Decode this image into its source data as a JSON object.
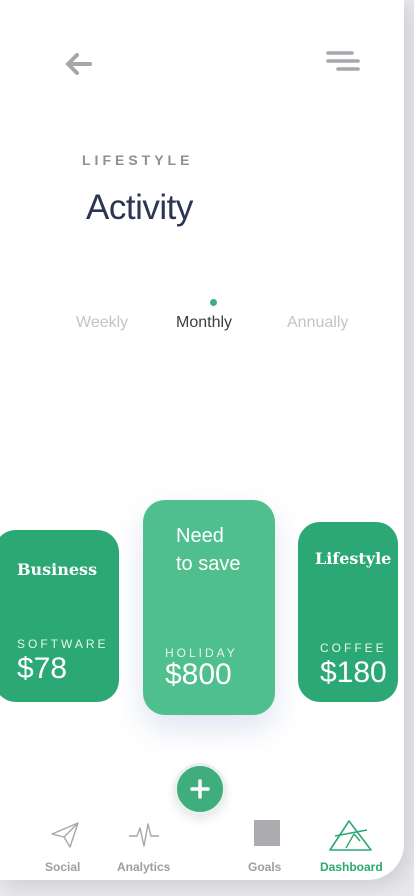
{
  "header": {
    "back_icon": "arrow-left-icon",
    "menu_icon": "menu-lines-icon",
    "category": "LIFESTYLE",
    "title": "Activity"
  },
  "tabs": [
    {
      "label": "Weekly",
      "active": false
    },
    {
      "label": "Monthly",
      "active": true
    },
    {
      "label": "Annually",
      "active": false
    }
  ],
  "cards": [
    {
      "title": "Business",
      "subtitle": "SOFTWARE",
      "amount": "$78"
    },
    {
      "title_line1": "Need",
      "title_line2": "to save",
      "subtitle": "HOLIDAY",
      "amount": "$800"
    },
    {
      "title": "Lifestyle",
      "subtitle": "COFFEE",
      "amount": "$180"
    }
  ],
  "fab": {
    "icon": "plus-icon"
  },
  "nav": [
    {
      "label": "Social",
      "icon": "paper-plane-icon",
      "active": false
    },
    {
      "label": "Analytics",
      "icon": "pulse-icon",
      "active": false
    },
    {
      "label": "Goals",
      "icon": "square-icon",
      "active": false
    },
    {
      "label": "Dashboard",
      "icon": "send-triangle-icon",
      "active": true
    }
  ],
  "colors": {
    "accent": "#2ca874",
    "accent_light": "#4fbf8d",
    "title": "#2c3552",
    "muted": "#9d9da4"
  }
}
